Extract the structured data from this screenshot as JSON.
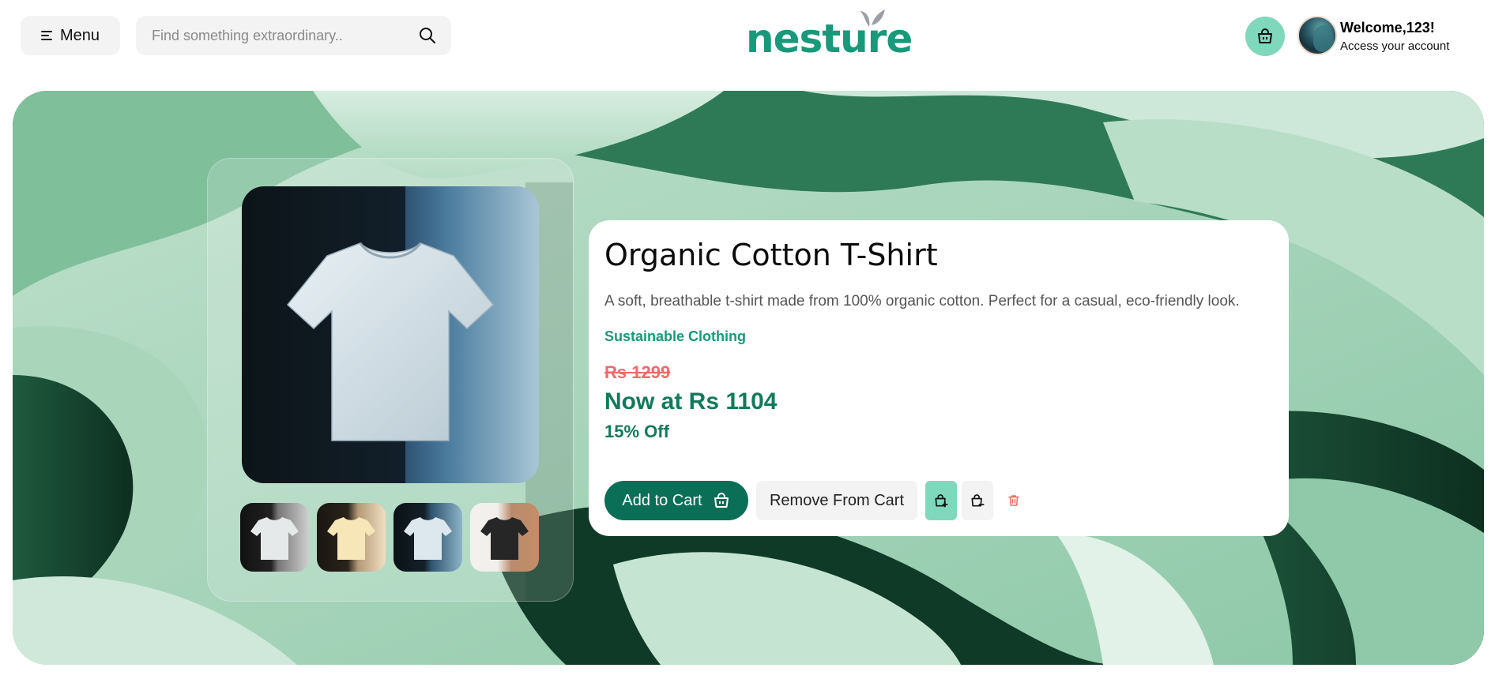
{
  "header": {
    "menu_label": "Menu",
    "search_placeholder": "Find something extraordinary..",
    "logo_text": "nesture",
    "welcome_title": "Welcome,123!",
    "welcome_sub": "Access your account"
  },
  "product": {
    "title": "Organic Cotton T-Shirt",
    "description": "A soft, breathable t-shirt made from 100% organic cotton. Perfect for a casual, eco-friendly look.",
    "category": "Sustainable Clothing",
    "old_price": "Rs 1299",
    "new_price": "Now at Rs 1104",
    "discount": "15% Off",
    "add_to_cart_label": "Add to Cart",
    "remove_from_cart_label": "Remove From Cart",
    "thumbnails": [
      "white-tshirt-dark-bg",
      "cream-tshirt",
      "white-tshirt-blue-bg",
      "black-tshirt"
    ]
  },
  "colors": {
    "brand_green": "#17997a",
    "dark_green": "#0b6e57",
    "mint": "#7fd8bc",
    "strike_red": "#f06a6a"
  },
  "icons": [
    "menu-icon",
    "search-icon",
    "leaf-icon",
    "shopping-bag-icon",
    "bag-plus-icon",
    "bag-minus-icon",
    "trash-icon"
  ]
}
